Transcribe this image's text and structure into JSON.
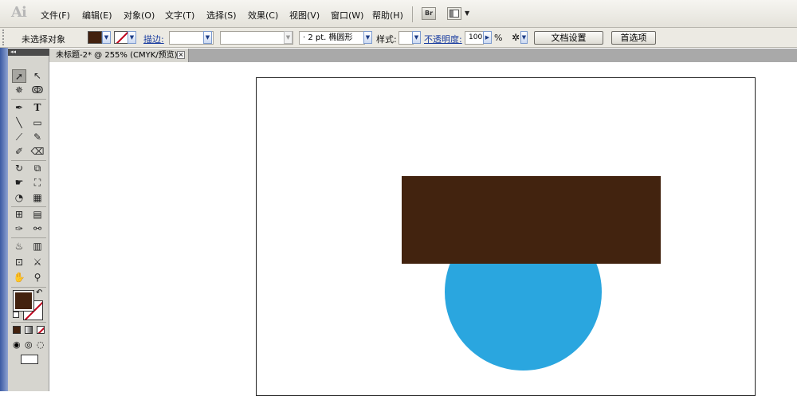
{
  "app": {
    "logo": "Ai",
    "menu": [
      "文件(F)",
      "编辑(E)",
      "对象(O)",
      "文字(T)",
      "选择(S)",
      "效果(C)",
      "视图(V)",
      "窗口(W)",
      "帮助(H)"
    ],
    "bridge_label": "Br"
  },
  "control_bar": {
    "selection_status": "未选择对象",
    "fill_color": "#43220f",
    "stroke_label": "描边:",
    "brush_value": "· 2 pt. 椭圆形",
    "style_label": "样式:",
    "opacity_label": "不透明度:",
    "opacity_value": "100",
    "opacity_unit": "%",
    "doc_setup_button": "文档设置",
    "preferences_button": "首选项"
  },
  "document_tab": {
    "title": "未标题-2* @ 255% (CMYK/预览)",
    "close_symbol": "⊠"
  },
  "toolbox": {
    "tools": [
      [
        "selection-tool-icon",
        "direct-selection-tool-icon"
      ],
      [
        "magic-wand-tool-icon",
        "lasso-tool-icon"
      ],
      [
        "pen-tool-icon",
        "type-tool-icon"
      ],
      [
        "line-segment-tool-icon",
        "rectangle-tool-icon"
      ],
      [
        "paintbrush-tool-icon",
        "pencil-tool-icon"
      ],
      [
        "blob-brush-tool-icon",
        "eraser-tool-icon"
      ],
      [
        "rotate-tool-icon",
        "scale-tool-icon"
      ],
      [
        "warp-tool-icon",
        "free-transform-tool-icon"
      ],
      [
        "shape-builder-tool-icon",
        "perspective-grid-tool-icon"
      ],
      [
        "mesh-tool-icon",
        "gradient-tool-icon"
      ],
      [
        "eyedropper-tool-icon",
        "blend-tool-icon"
      ],
      [
        "symbol-sprayer-tool-icon",
        "column-graph-tool-icon"
      ],
      [
        "artboard-tool-icon",
        "slice-tool-icon"
      ],
      [
        "hand-tool-icon",
        "zoom-tool-icon"
      ]
    ],
    "fill_swatch_color": "#43220f",
    "stroke_swatch": "none"
  },
  "canvas": {
    "shapes": [
      {
        "type": "rectangle",
        "fill": "#42230f"
      },
      {
        "type": "ellipse",
        "fill": "#2aa6df"
      }
    ]
  }
}
